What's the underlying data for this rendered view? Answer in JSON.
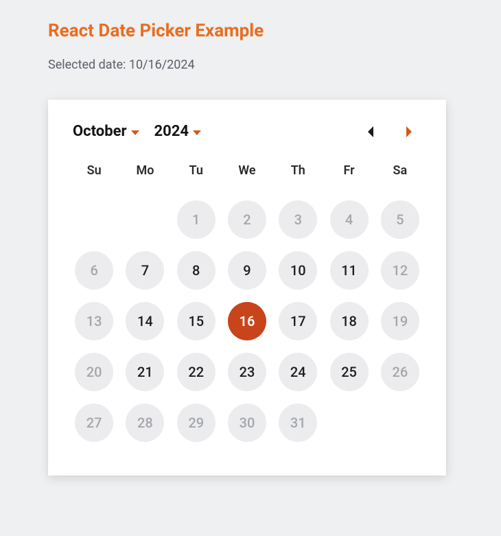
{
  "title": "React Date Picker Example",
  "selected_label": "Selected date: ",
  "selected_value": "10/16/2024",
  "month_label": "October",
  "year_label": "2024",
  "weekdays": [
    "Su",
    "Mo",
    "Tu",
    "We",
    "Th",
    "Fr",
    "Sa"
  ],
  "days": [
    {
      "d": "",
      "state": "empty"
    },
    {
      "d": "",
      "state": "empty"
    },
    {
      "d": "1",
      "state": "outside"
    },
    {
      "d": "2",
      "state": "outside"
    },
    {
      "d": "3",
      "state": "outside"
    },
    {
      "d": "4",
      "state": "outside"
    },
    {
      "d": "5",
      "state": "outside"
    },
    {
      "d": "6",
      "state": "outside"
    },
    {
      "d": "7",
      "state": "in"
    },
    {
      "d": "8",
      "state": "in"
    },
    {
      "d": "9",
      "state": "in"
    },
    {
      "d": "10",
      "state": "in"
    },
    {
      "d": "11",
      "state": "in"
    },
    {
      "d": "12",
      "state": "outside"
    },
    {
      "d": "13",
      "state": "outside"
    },
    {
      "d": "14",
      "state": "in"
    },
    {
      "d": "15",
      "state": "in"
    },
    {
      "d": "16",
      "state": "selected"
    },
    {
      "d": "17",
      "state": "in"
    },
    {
      "d": "18",
      "state": "in"
    },
    {
      "d": "19",
      "state": "outside"
    },
    {
      "d": "20",
      "state": "outside"
    },
    {
      "d": "21",
      "state": "in"
    },
    {
      "d": "22",
      "state": "in"
    },
    {
      "d": "23",
      "state": "in"
    },
    {
      "d": "24",
      "state": "in"
    },
    {
      "d": "25",
      "state": "in"
    },
    {
      "d": "26",
      "state": "outside"
    },
    {
      "d": "27",
      "state": "outside"
    },
    {
      "d": "28",
      "state": "outside"
    },
    {
      "d": "29",
      "state": "outside"
    },
    {
      "d": "30",
      "state": "outside"
    },
    {
      "d": "31",
      "state": "outside"
    }
  ],
  "colors": {
    "accent": "#e86d1f",
    "selected_bg": "#c8441b"
  }
}
